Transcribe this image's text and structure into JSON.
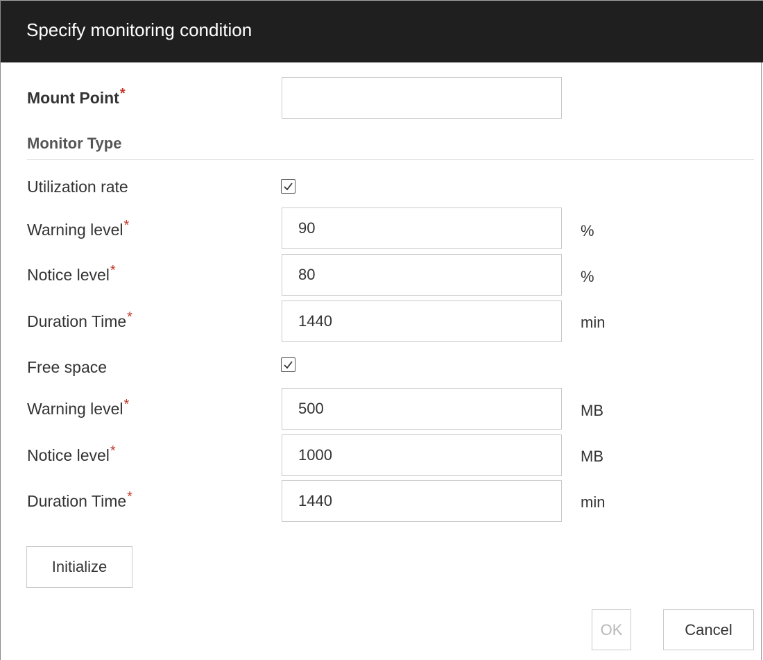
{
  "dialog": {
    "title": "Specify monitoring condition"
  },
  "mount_point": {
    "label": "Mount Point",
    "required_mark": "*",
    "value": ""
  },
  "monitor_type": {
    "label": "Monitor Type"
  },
  "utilization": {
    "label": "Utilization rate",
    "checked": true,
    "warning": {
      "label": "Warning level",
      "required_mark": "*",
      "value": "90",
      "unit": "%"
    },
    "notice": {
      "label": "Notice level",
      "required_mark": "*",
      "value": "80",
      "unit": "%"
    },
    "duration": {
      "label": "Duration Time",
      "required_mark": "*",
      "value": "1440",
      "unit": "min"
    }
  },
  "free_space": {
    "label": "Free space",
    "checked": true,
    "warning": {
      "label": "Warning level",
      "required_mark": "*",
      "value": "500",
      "unit": "MB"
    },
    "notice": {
      "label": "Notice level",
      "required_mark": "*",
      "value": "1000",
      "unit": "MB"
    },
    "duration": {
      "label": "Duration Time",
      "required_mark": "*",
      "value": "1440",
      "unit": "min"
    }
  },
  "buttons": {
    "initialize": "Initialize",
    "ok": "OK",
    "ok_disabled": true,
    "cancel": "Cancel"
  },
  "colors": {
    "title_bar": "#1f1f1f",
    "required_mark": "#c0392b"
  }
}
